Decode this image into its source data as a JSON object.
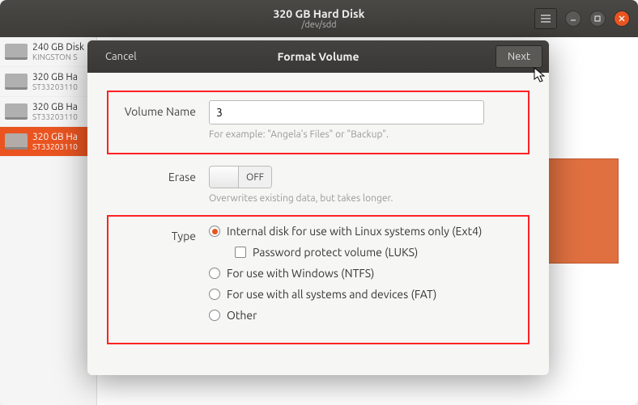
{
  "window": {
    "title": "320 GB Hard Disk",
    "subtitle": "/dev/sdd"
  },
  "sidebar": {
    "items": [
      {
        "name": "240 GB Disk",
        "sub": "KINGSTON S"
      },
      {
        "name": "320 GB Ha",
        "sub": "ST33203110"
      },
      {
        "name": "320 GB Ha",
        "sub": "ST33203110"
      },
      {
        "name": "320 GB Ha",
        "sub": "ST33203110"
      }
    ]
  },
  "dialog": {
    "cancel": "Cancel",
    "title": "Format Volume",
    "next": "Next",
    "volume_name_label": "Volume Name",
    "volume_name_value": "3",
    "volume_name_hint": "For example: \"Angela's Files\" or \"Backup\".",
    "erase_label": "Erase",
    "erase_state": "OFF",
    "erase_hint": "Overwrites existing data, but takes longer.",
    "type_label": "Type",
    "type_options": {
      "ext4": "Internal disk for use with Linux systems only (Ext4)",
      "luks": "Password protect volume (LUKS)",
      "ntfs": "For use with Windows (NTFS)",
      "fat": "For use with all systems and devices (FAT)",
      "other": "Other"
    }
  }
}
